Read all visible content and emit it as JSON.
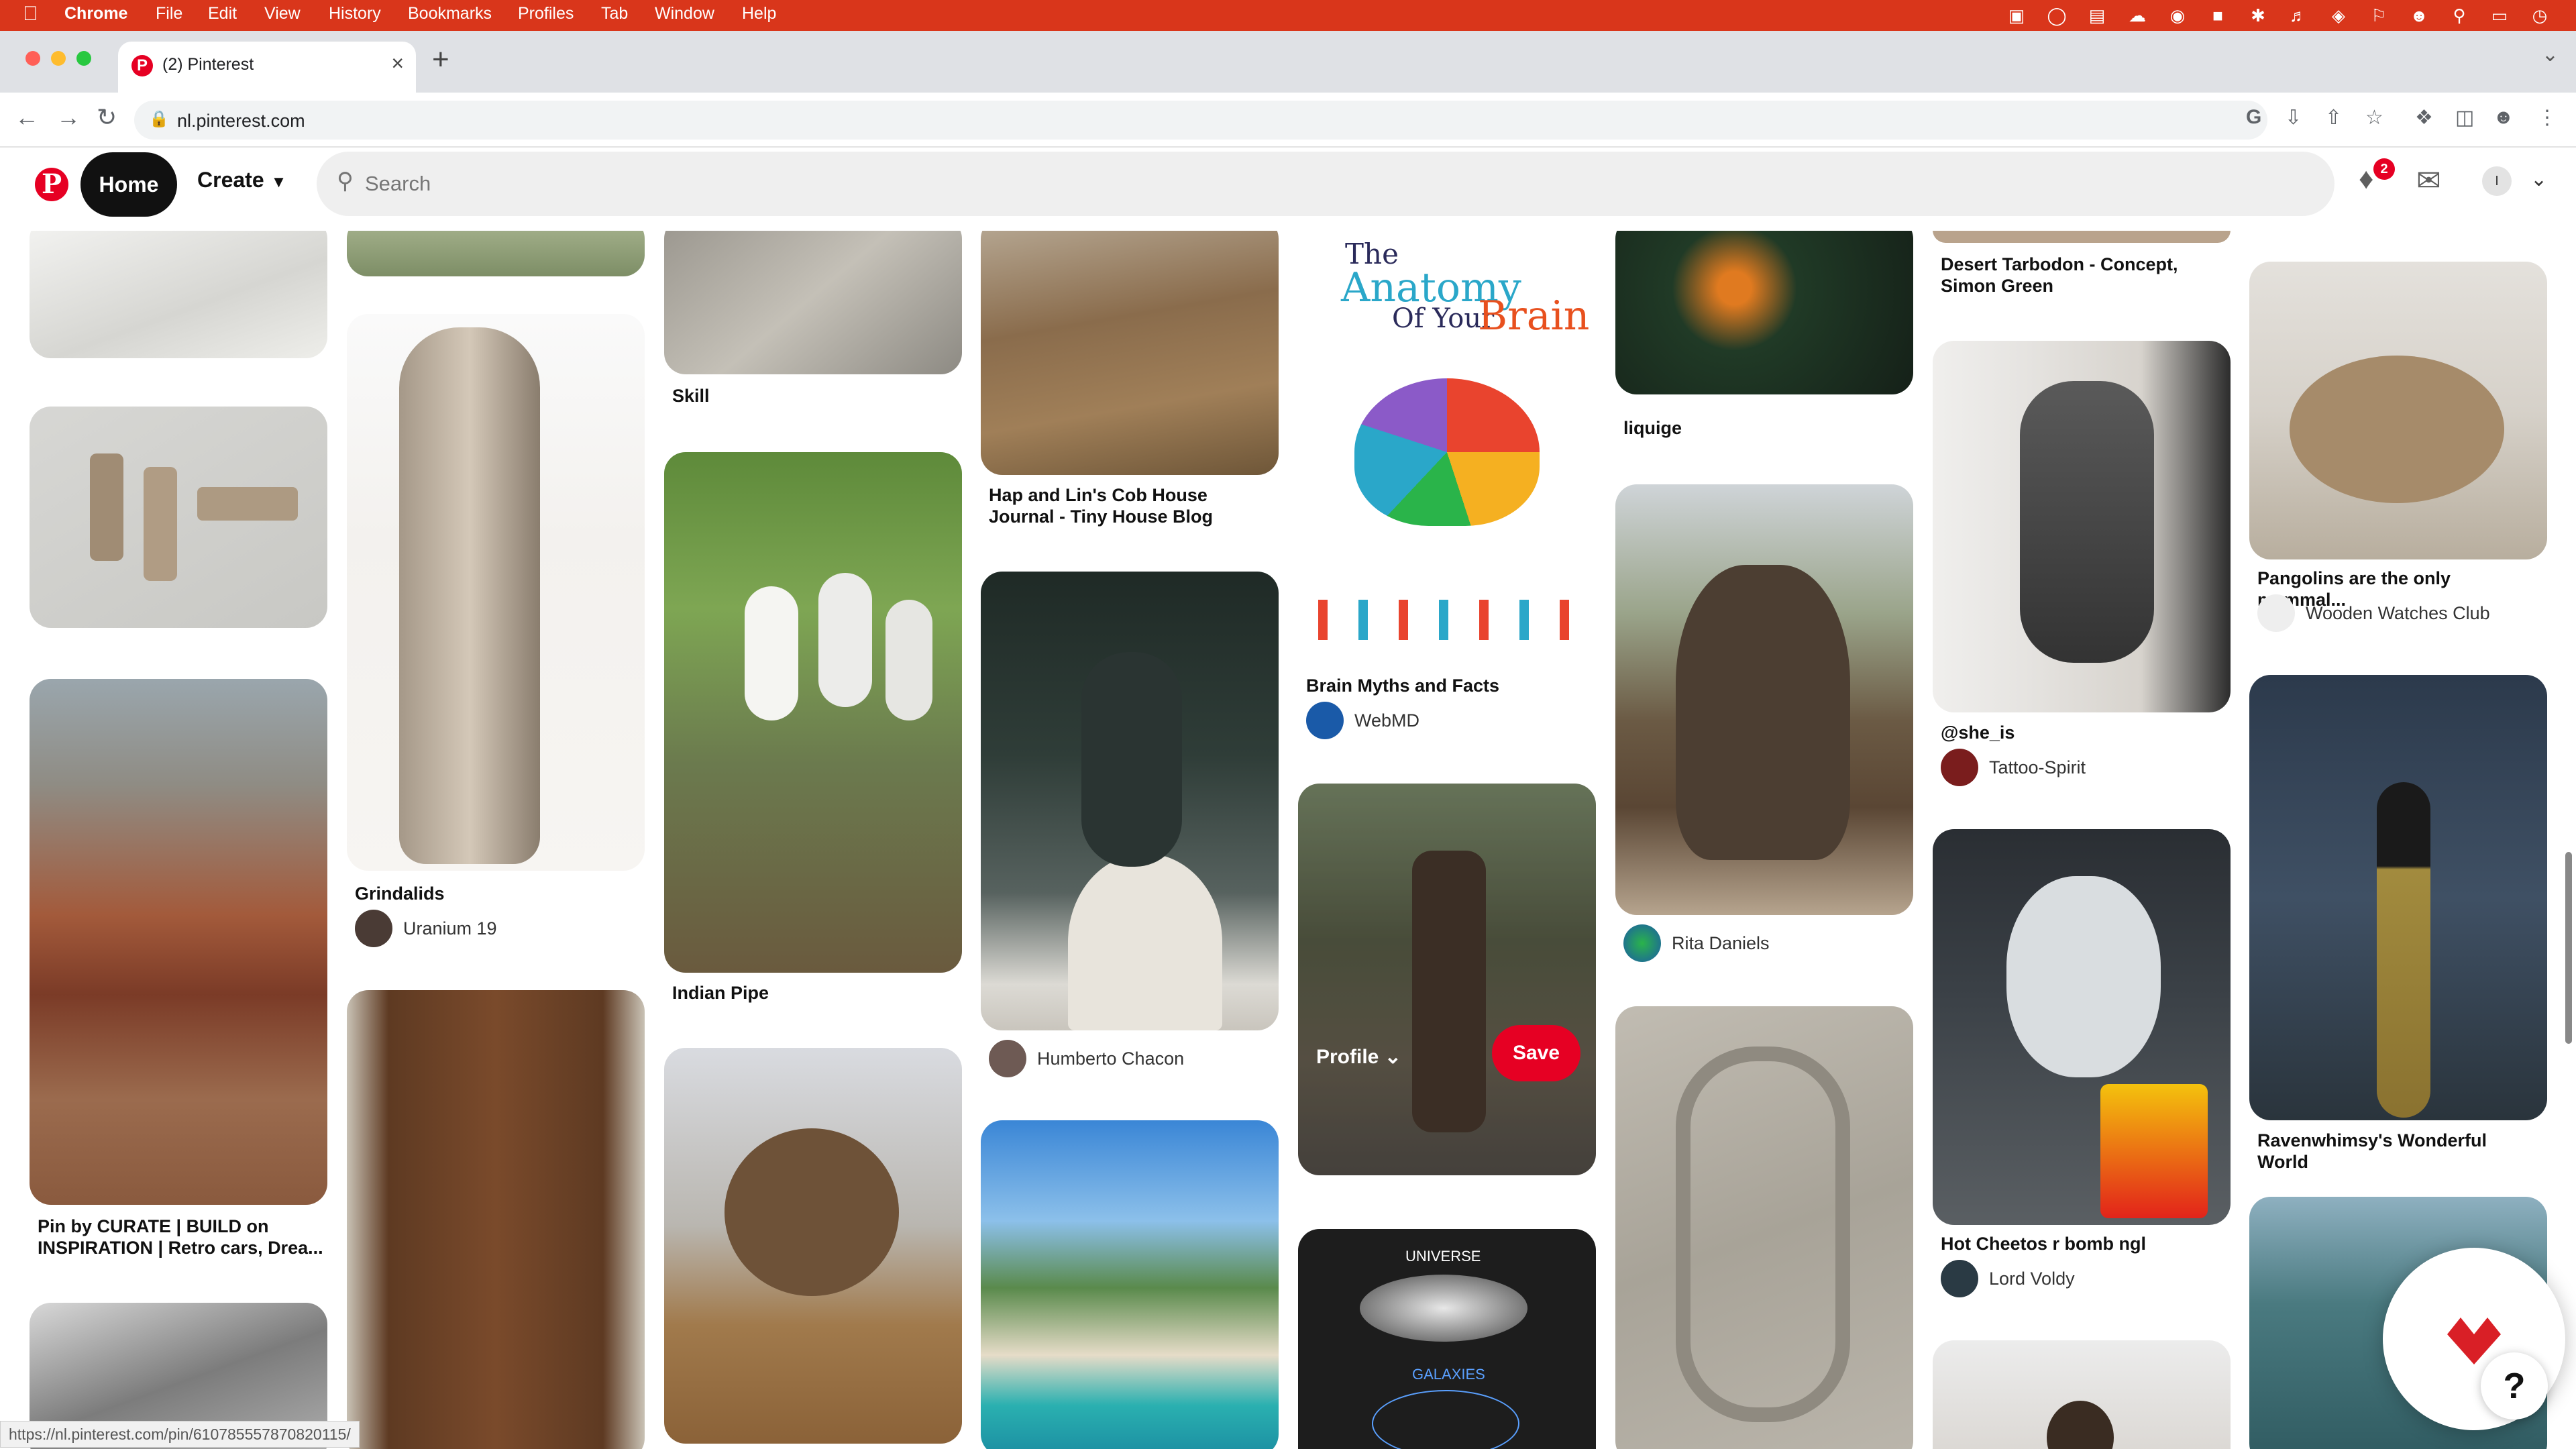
{
  "menubar": {
    "apple": "",
    "app": "Chrome",
    "items": [
      "File",
      "Edit",
      "View",
      "History",
      "Bookmarks",
      "Profiles",
      "Tab",
      "Window",
      "Help"
    ],
    "status_icons": [
      "screen-mirror-icon",
      "circle-icon",
      "display-icon",
      "cloud-icon",
      "record-icon",
      "s-icon",
      "bluetooth-icon",
      "volume-icon",
      "wifi-icon",
      "flag-icon",
      "user-icon",
      "search-icon",
      "battery-icon",
      "clock-icon"
    ]
  },
  "browser": {
    "tab_title": "(2) Pinterest",
    "tab_close": "×",
    "new_tab": "+",
    "url": "nl.pinterest.com",
    "status_url": "https://nl.pinterest.com/pin/610785557870820115/"
  },
  "pinterest": {
    "logo": "P",
    "home": "Home",
    "create": "Create",
    "search_placeholder": "Search",
    "notification_count": "2",
    "avatar_initial": "I",
    "profile_dropdown": "Profile",
    "save": "Save",
    "help": "?"
  },
  "pins": {
    "grindalids": {
      "title": "Grindalids",
      "author": "Uranium 19"
    },
    "skill": {
      "title": "Skill"
    },
    "hap_lin": {
      "title": "Hap and Lin's Cob House Journal - Tiny House Blog"
    },
    "brain": {
      "title": "Brain Myths and Facts",
      "author": "WebMD",
      "poster_line1": "The",
      "poster_line2": "Anatomy",
      "poster_line3": "Of Your",
      "poster_line4": "Brain"
    },
    "liquige": {
      "title": "liquige"
    },
    "desert": {
      "title": "Desert Tarbodon - Concept, Simon Green"
    },
    "pangolins": {
      "title": "Pangolins are the only mammal...",
      "author": "Wooden Watches Club"
    },
    "indian_pipe": {
      "title": "Indian Pipe"
    },
    "humberto": {
      "author": "Humberto Chacon"
    },
    "rita": {
      "author": "Rita Daniels"
    },
    "she_is": {
      "title": "@she_is",
      "author": "Tattoo-Spirit"
    },
    "curate": {
      "title": "Pin by CURATE | BUILD on INSPIRATION | Retro cars, Drea..."
    },
    "cheetos": {
      "title": "Hot Cheetos r bomb ngl",
      "author": "Lord Voldy"
    },
    "ravenwhimsy": {
      "title": "Ravenwhimsy's Wonderful World"
    },
    "universe": {
      "title_line1": "UNIVERSE",
      "title_line2": "GALAXIES"
    }
  },
  "colors": {
    "menubar": "#d9361b",
    "pinterest_red": "#e60023",
    "search_bg": "#efefef"
  }
}
